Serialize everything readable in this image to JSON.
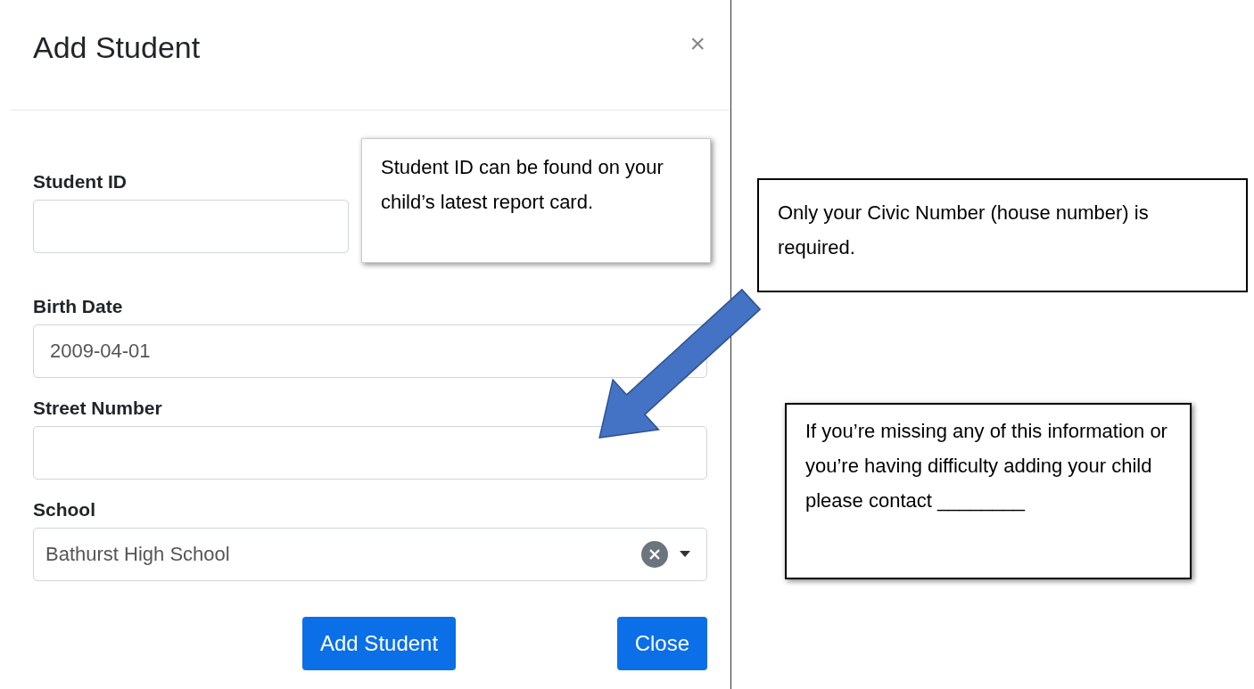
{
  "modal": {
    "title": "Add Student",
    "close": "×",
    "fields": [
      {
        "kind": "short-text",
        "label": "Student ID"
      },
      {
        "kind": "text",
        "label": "Birth Date",
        "value": "2009-04-01"
      },
      {
        "kind": "text",
        "label": "Street Number"
      },
      {
        "kind": "select",
        "label": "School",
        "value": "Bathurst High School"
      }
    ],
    "buttons": [
      "Add Student",
      "Close"
    ]
  },
  "callouts": [
    {
      "kind": "shadow",
      "text": "Student ID can be found on your child’s latest report card."
    },
    {
      "kind": "outline",
      "text": "Only your Civic Number (house number) is required."
    },
    {
      "kind": "outline-shadow",
      "text": "If you’re missing any of this information or you’re having difficulty adding your child please contact ________"
    }
  ]
}
